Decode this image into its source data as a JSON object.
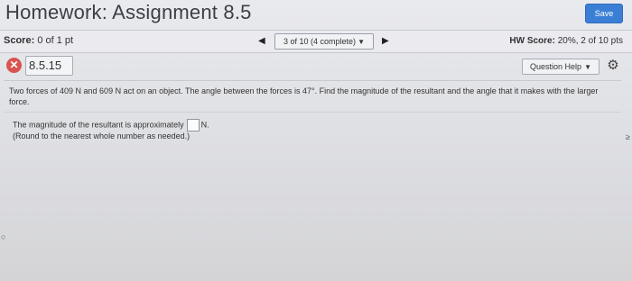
{
  "header": {
    "title": "Homework: Assignment 8.5",
    "save_label": "Save"
  },
  "scorebar": {
    "score_label": "Score:",
    "score_value": "0 of 1 pt",
    "pager_prev_icon": "left-triangle",
    "pager_text": "3 of 10 (4 complete)",
    "pager_next_icon": "right-triangle",
    "hw_score_label": "HW Score:",
    "hw_score_value": "20%, 2 of 10 pts"
  },
  "question_row": {
    "status_icon": "x-mark",
    "question_id": "8.5.15",
    "help_label": "Question Help",
    "settings_icon": "gear"
  },
  "question": {
    "text": "Two forces of 409 N and 609 N act on an object. The angle between the forces is 47°. Find the magnitude of the resultant and the angle that it makes with the larger force."
  },
  "answer": {
    "prompt": "The magnitude of the resultant is approximately",
    "unit": "N.",
    "value": "",
    "note": "(Round to the nearest whole number as needed.)"
  },
  "colors": {
    "save_button": "#3a7fd5",
    "incorrect_icon": "#d9534f"
  }
}
